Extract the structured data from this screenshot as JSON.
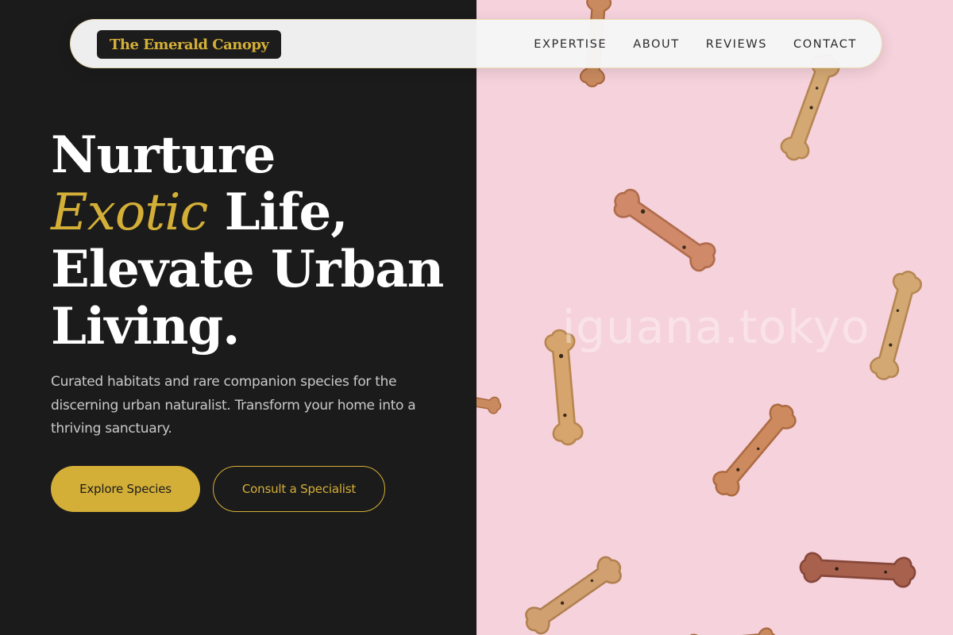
{
  "brand": {
    "name": "The Emerald Canopy"
  },
  "nav": {
    "items": [
      {
        "label": "EXPERTISE"
      },
      {
        "label": "ABOUT"
      },
      {
        "label": "REVIEWS"
      },
      {
        "label": "CONTACT"
      }
    ]
  },
  "hero": {
    "headline_line1": "Nurture",
    "headline_accent": "Exotic",
    "headline_line2_rest": " Life,",
    "headline_line3": "Elevate Urban",
    "headline_line4": "Living.",
    "subcopy": "Curated habitats and rare companion species for the discerning urban naturalist. Transform your home into a thriving sanctuary.",
    "primary_cta": "Explore Species",
    "secondary_cta": "Consult a Specialist"
  },
  "image": {
    "watermark": "iguana.tokyo",
    "subject": "dog-bone-biscuits-on-pink"
  },
  "colors": {
    "accent": "#d4af37",
    "dark": "#1b1b1b",
    "pink": "#f6d2dc"
  }
}
